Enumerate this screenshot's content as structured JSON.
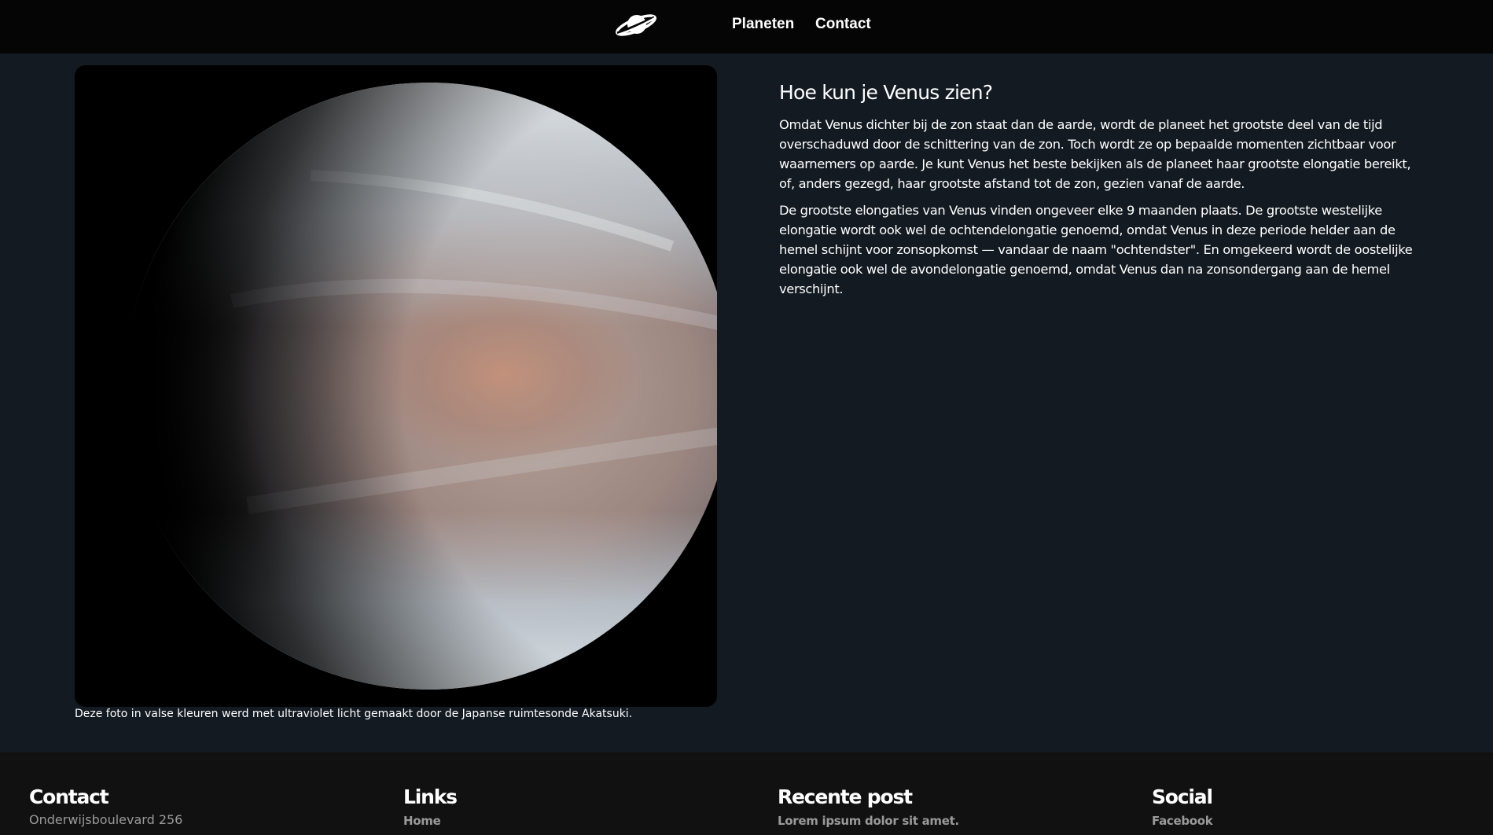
{
  "nav": {
    "logo_icon": "saturn-icon",
    "items": [
      {
        "label": "Planeten"
      },
      {
        "label": "Contact"
      }
    ]
  },
  "main": {
    "image": {
      "subject": "venus-icon",
      "caption": "Deze foto in valse kleuren werd met ultraviolet licht gemaakt door de Japanse ruimtesonde Akatsuki."
    },
    "article": {
      "title": "Hoe kun je Venus zien?",
      "paragraphs": [
        "Omdat Venus dichter bij de zon staat dan de aarde, wordt de planeet het grootste deel van de tijd overschaduwd door de schittering van de zon. Toch wordt ze op bepaalde momenten zichtbaar voor waarnemers op aarde. Je kunt Venus het beste bekijken als de planeet haar grootste elongatie bereikt, of, anders gezegd, haar grootste afstand tot de zon, gezien vanaf de aarde.",
        "De grootste elongaties van Venus vinden ongeveer elke 9 maanden plaats. De grootste westelijke elongatie wordt ook wel de ochtendelongatie genoemd, omdat Venus in deze periode helder aan de hemel schijnt voor zonsopkomst — vandaar de naam \"ochtendster\". En omgekeerd wordt de oostelijke elongatie ook wel de avondelongatie genoemd, omdat Venus dan na zonsondergang aan de hemel verschijnt."
      ]
    }
  },
  "footer": {
    "contact": {
      "heading": "Contact",
      "text": "Onderwijsboulevard 256"
    },
    "links": {
      "heading": "Links",
      "item": "Home"
    },
    "recent": {
      "heading": "Recente post",
      "item": "Lorem ipsum dolor sit amet."
    },
    "social": {
      "heading": "Social",
      "item": "Facebook"
    }
  },
  "colors": {
    "nav_bg": "#050505",
    "page_bg": "#131a21",
    "footer_bg": "#111111",
    "footer_text": "#9a9a9a"
  }
}
